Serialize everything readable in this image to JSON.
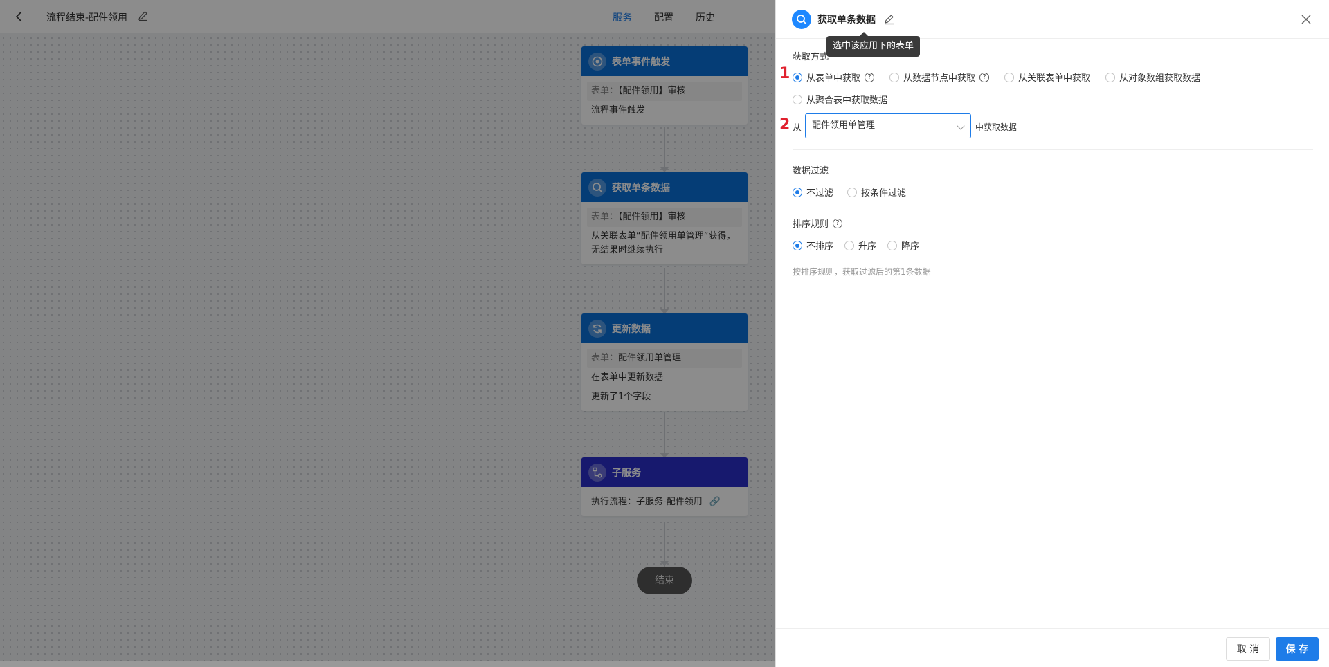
{
  "topbar": {
    "title": "流程结束-配件领用",
    "nav": [
      "服务",
      "配置",
      "历史"
    ],
    "active_nav": "服务"
  },
  "nodes": [
    {
      "name": "表单事件触发",
      "icon": "target-icon",
      "color": "#0a6fd8",
      "rows": [
        {
          "k": "表单：",
          "v": "【配件领用】审核",
          "grey": true
        },
        {
          "k": "",
          "v": "流程事件触发",
          "grey": false
        }
      ]
    },
    {
      "name": "获取单条数据",
      "icon": "search-icon",
      "color": "#0a6fd8",
      "rows": [
        {
          "k": "表单：",
          "v": "【配件领用】审核",
          "grey": true
        },
        {
          "k": "",
          "v": "从关联表单“配件领用单管理”获得，无结果时继续执行",
          "grey": false
        }
      ]
    },
    {
      "name": "更新数据",
      "icon": "refresh-icon",
      "color": "#0a6fd8",
      "rows": [
        {
          "k": "表单：",
          "v": "配件领用单管理",
          "grey": true
        },
        {
          "k": "",
          "v": "在表单中更新数据",
          "grey": false
        },
        {
          "k": "",
          "v": "更新了1个字段",
          "grey": false
        }
      ]
    },
    {
      "name": "子服务",
      "icon": "subflow-icon",
      "color": "#2a2fc9",
      "rows": [
        {
          "k": "",
          "v": "执行流程：子服务-配件领用",
          "grey": false
        }
      ]
    }
  ],
  "end_label": "结束",
  "panel": {
    "title": "获取单条数据",
    "tooltip": "选中该应用下的表单",
    "fetch_method_label": "获取方式",
    "marker_1": "1",
    "marker_2": "2",
    "fetch_options": [
      "从表单中获取",
      "从数据节点中获取",
      "从关联表单中获取",
      "从对象数组获取数据",
      "从聚合表中获取数据"
    ],
    "fetch_selected": "从表单中获取",
    "from_label": "从",
    "form_select_value": "配件领用单管理",
    "from_suffix": "中获取数据",
    "filter_label": "数据过滤",
    "filter_options": [
      "不过滤",
      "按条件过滤"
    ],
    "filter_selected": "不过滤",
    "sort_label": "排序规则",
    "sort_options": [
      "不排序",
      "升序",
      "降序"
    ],
    "sort_selected": "不排序",
    "hint": "按排序规则，获取过滤后的第1条数据",
    "cancel_label": "取 消",
    "save_label": "保 存"
  },
  "colors": {
    "accent": "#1e7ce8",
    "marker": "#e0212e"
  }
}
